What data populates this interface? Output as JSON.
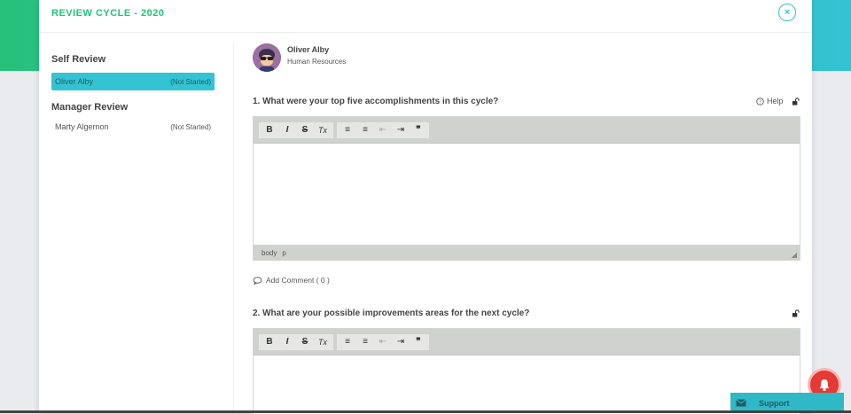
{
  "modal": {
    "title": "REVIEW CYCLE - 2020",
    "close_label": "×"
  },
  "sidebar": {
    "self_review_heading": "Self Review",
    "self_items": [
      {
        "name": "Oliver Alby",
        "status": "(Not Started)"
      }
    ],
    "manager_review_heading": "Manager Review",
    "manager_items": [
      {
        "name": "Marty Algernon",
        "status": "(Not Started)"
      }
    ]
  },
  "user": {
    "name": "Oliver Alby",
    "department": "Human Resources"
  },
  "questions": [
    {
      "text": "1. What were your top five accomplishments in this cycle?",
      "help_label": "Help",
      "statusbar": [
        "body",
        "p"
      ],
      "add_comment_label": "Add Comment ( 0 )"
    },
    {
      "text": "2. What are your possible improvements areas for the next cycle?"
    }
  ],
  "toolbar": {
    "bold": "B",
    "italic": "I",
    "strike": "S",
    "clear": "Tx",
    "ordered_list": "≡",
    "bullet_list": "≡",
    "outdent": "⇤",
    "indent": "⇥",
    "quote": "❞"
  },
  "support": {
    "label": "Support"
  },
  "icons": {
    "close": "close-icon",
    "help": "question-circle-icon",
    "lock": "unlock-icon",
    "comment": "comment-icon",
    "bell": "bell-icon",
    "mail": "envelope-icon"
  },
  "colors": {
    "accent": "#33c3d2",
    "title_green": "#27c17a",
    "notification": "#e53935"
  }
}
